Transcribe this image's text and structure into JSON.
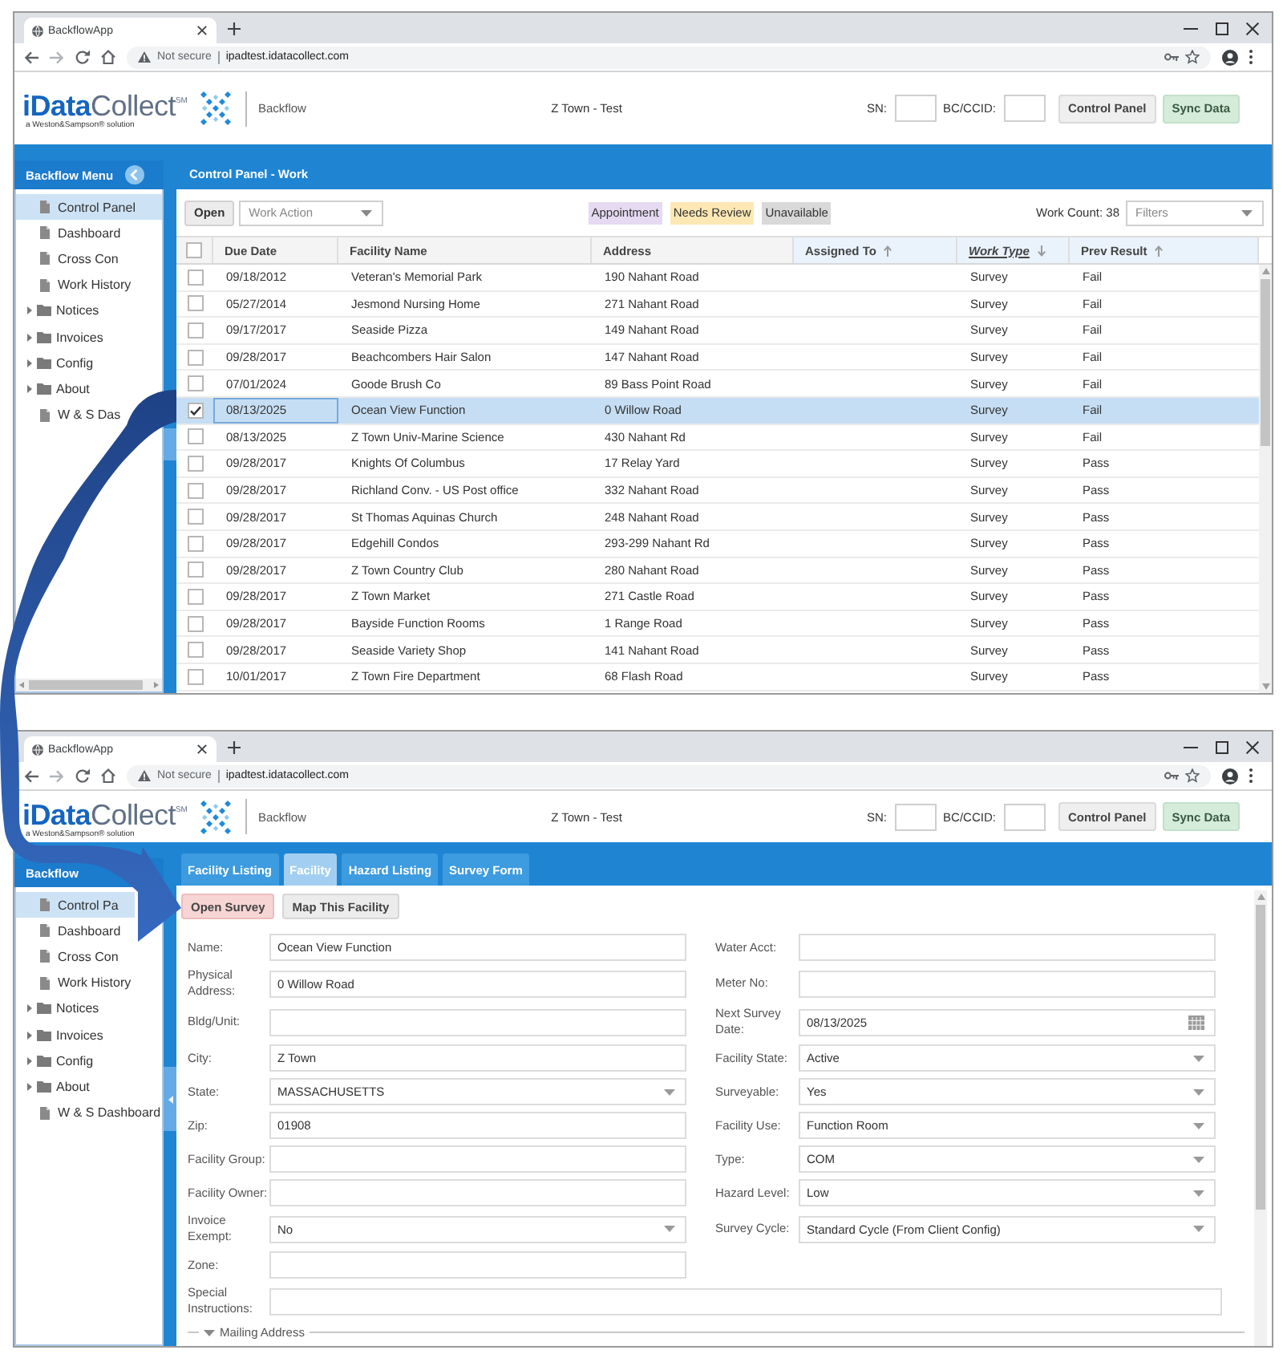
{
  "windows": [
    {
      "kind": "work_list",
      "tab_title": "BackflowApp",
      "security": "Not secure",
      "url": "ipadtest.idatacollect.com",
      "header": {
        "brand": "**iData**Collect$^{SM}$",
        "tagline": "a Weston&Sampson® solution",
        "module": "Backflow",
        "site": "Z Town - Test",
        "sn_label": "SN:",
        "bc_label": "BC/CCID:",
        "buttons": [
          {
            "label": "Control Panel",
            "kind": "default"
          },
          {
            "label": "Sync Data",
            "kind": "sync"
          }
        ]
      },
      "sidebar": {
        "title": "Backflow Menu",
        "items": [
          {
            "label": "Control Panel",
            "kind": "page",
            "selected": true
          },
          {
            "label": "Dashboard",
            "kind": "page",
            "selected": false
          },
          {
            "label": "Cross Con",
            "kind": "page",
            "selected": false
          },
          {
            "label": "Work History",
            "kind": "page",
            "selected": false
          },
          {
            "label": "Notices",
            "kind": "folder",
            "selected": false
          },
          {
            "label": "Invoices",
            "kind": "folder",
            "selected": false
          },
          {
            "label": "Config",
            "kind": "folder",
            "selected": false
          },
          {
            "label": "About",
            "kind": "folder",
            "selected": false
          },
          {
            "label": "W & S Das",
            "kind": "page",
            "selected": false
          }
        ]
      },
      "panel": {
        "title": "Control Panel - Work",
        "open_button": "Open",
        "work_action": {
          "placeholder": "Work Action"
        },
        "legend": [
          {
            "label": "Appointment",
            "color": "#e5daf2"
          },
          {
            "label": "Needs Review",
            "color": "#fde8b4"
          },
          {
            "label": "Unavailable",
            "color": "#d9d9d9"
          }
        ],
        "work_count": "Work Count: 38",
        "filters": {
          "placeholder": "Filters"
        },
        "table": {
          "select_all": false,
          "columns": [
            {
              "label": "Due Date",
              "sortable": false,
              "active": false
            },
            {
              "label": "Facility Name",
              "sortable": false,
              "active": false
            },
            {
              "label": "Address",
              "sortable": false,
              "active": false
            },
            {
              "label": "Assigned To",
              "sortable": true,
              "active": false
            },
            {
              "label": "Work Type",
              "sortable": true,
              "active": true
            },
            {
              "label": "Prev Result",
              "sortable": true,
              "active": false
            }
          ],
          "rows": [
            {
              "due_date": "09/18/2012",
              "facility": "Veteran's Memorial Park",
              "address": "190 Nahant Road",
              "work_type": "Survey",
              "prev_result": "Fail",
              "selected": false
            },
            {
              "due_date": "05/27/2014",
              "facility": "Jesmond Nursing Home",
              "address": "271 Nahant Road",
              "work_type": "Survey",
              "prev_result": "Fail",
              "selected": false
            },
            {
              "due_date": "09/17/2017",
              "facility": "Seaside Pizza",
              "address": "149 Nahant Road",
              "work_type": "Survey",
              "prev_result": "Fail",
              "selected": false
            },
            {
              "due_date": "09/28/2017",
              "facility": "Beachcombers Hair Salon",
              "address": "147 Nahant Road",
              "work_type": "Survey",
              "prev_result": "Fail",
              "selected": false
            },
            {
              "due_date": "07/01/2024",
              "facility": "Goode Brush Co",
              "address": "89 Bass Point Road",
              "work_type": "Survey",
              "prev_result": "Fail",
              "selected": false
            },
            {
              "due_date": "08/13/2025",
              "facility": "Ocean View Function",
              "address": "0 Willow Road",
              "work_type": "Survey",
              "prev_result": "Fail",
              "selected": true
            },
            {
              "due_date": "08/13/2025",
              "facility": "Z Town Univ-Marine Science",
              "address": "430 Nahant Rd",
              "work_type": "Survey",
              "prev_result": "Fail",
              "selected": false
            },
            {
              "due_date": "09/28/2017",
              "facility": "Knights Of Columbus",
              "address": "17 Relay Yard",
              "work_type": "Survey",
              "prev_result": "Pass",
              "selected": false
            },
            {
              "due_date": "09/28/2017",
              "facility": "Richland Conv. - US Post office",
              "address": "332 Nahant Road",
              "work_type": "Survey",
              "prev_result": "Pass",
              "selected": false
            },
            {
              "due_date": "09/28/2017",
              "facility": "St Thomas Aquinas Church",
              "address": "248 Nahant Road",
              "work_type": "Survey",
              "prev_result": "Pass",
              "selected": false
            },
            {
              "due_date": "09/28/2017",
              "facility": "Edgehill Condos",
              "address": "293-299 Nahant Rd",
              "work_type": "Survey",
              "prev_result": "Pass",
              "selected": false
            },
            {
              "due_date": "09/28/2017",
              "facility": "Z Town Country Club",
              "address": "280 Nahant Road",
              "work_type": "Survey",
              "prev_result": "Pass",
              "selected": false
            },
            {
              "due_date": "09/28/2017",
              "facility": "Z Town Market",
              "address": "271 Castle Road",
              "work_type": "Survey",
              "prev_result": "Pass",
              "selected": false
            },
            {
              "due_date": "09/28/2017",
              "facility": "Bayside Function Rooms",
              "address": "1 Range Road",
              "work_type": "Survey",
              "prev_result": "Pass",
              "selected": false
            },
            {
              "due_date": "09/28/2017",
              "facility": "Seaside Variety Shop",
              "address": "141 Nahant Road",
              "work_type": "Survey",
              "prev_result": "Pass",
              "selected": false
            },
            {
              "due_date": "10/01/2017",
              "facility": "Z Town Fire Department",
              "address": "68 Flash Road",
              "work_type": "Survey",
              "prev_result": "Pass",
              "selected": false
            }
          ]
        }
      }
    },
    {
      "kind": "facility_form",
      "tab_title": "BackflowApp",
      "security": "Not secure",
      "url": "ipadtest.idatacollect.com",
      "header": {
        "brand": "**iData**Collect$^{SM}$",
        "tagline": "a Weston&Sampson® solution",
        "module": "Backflow",
        "site": "Z Town - Test",
        "sn_label": "SN:",
        "bc_label": "BC/CCID:",
        "buttons": [
          {
            "label": "Control Panel",
            "kind": "default"
          },
          {
            "label": "Sync Data",
            "kind": "sync"
          }
        ]
      },
      "sidebar": {
        "title": "Backflow",
        "items": [
          {
            "label": "Control Pa",
            "kind": "page",
            "selected": true
          },
          {
            "label": "Dashboard",
            "kind": "page",
            "selected": false
          },
          {
            "label": "Cross Con",
            "kind": "page",
            "selected": false
          },
          {
            "label": "Work History",
            "kind": "page",
            "selected": false
          },
          {
            "label": "Notices",
            "kind": "folder",
            "selected": false
          },
          {
            "label": "Invoices",
            "kind": "folder",
            "selected": false
          },
          {
            "label": "Config",
            "kind": "folder",
            "selected": false
          },
          {
            "label": "About",
            "kind": "folder",
            "selected": false
          },
          {
            "label": "W & S Dashboard",
            "kind": "page",
            "selected": false
          }
        ]
      },
      "panel": {
        "tabs": [
          {
            "label": "Facility Listing",
            "selected": false
          },
          {
            "label": "Facility",
            "selected": true
          },
          {
            "label": "Hazard Listing",
            "selected": false
          },
          {
            "label": "Survey Form",
            "selected": false
          }
        ],
        "actions": [
          {
            "label": "Open Survey",
            "kind": "primary"
          },
          {
            "label": "Map This Facility",
            "kind": "default"
          }
        ],
        "form": {
          "rows": [
            [
              {
                "label": "Name:",
                "kind": "text",
                "value": "Ocean View Function"
              },
              {
                "label": "Water Acct:",
                "kind": "text"
              }
            ],
            [
              {
                "label": "Physical Address:",
                "kind": "text",
                "value": "0 Willow Road"
              },
              {
                "label": "Meter No:",
                "kind": "text"
              }
            ],
            [
              {
                "label": "Bldg/Unit:",
                "kind": "text"
              },
              {
                "label": "Next Survey Date:",
                "kind": "date",
                "value": "08/13/2025"
              }
            ],
            [
              {
                "label": "City:",
                "kind": "text",
                "value": "Z Town"
              },
              {
                "label": "Facility State:",
                "kind": "select",
                "value": "Active"
              }
            ],
            [
              {
                "label": "State:",
                "kind": "select",
                "value": "MASSACHUSETTS"
              },
              {
                "label": "Surveyable:",
                "kind": "select",
                "value": "Yes"
              }
            ],
            [
              {
                "label": "Zip:",
                "kind": "text",
                "value": "01908"
              },
              {
                "label": "Facility Use:",
                "kind": "select",
                "value": "Function Room"
              }
            ],
            [
              {
                "label": "Facility Group:",
                "kind": "text"
              },
              {
                "label": "Type:",
                "kind": "select",
                "value": "COM"
              }
            ],
            [
              {
                "label": "Facility Owner:",
                "kind": "text"
              },
              {
                "label": "Hazard Level:",
                "kind": "select",
                "value": "Low"
              }
            ],
            [
              {
                "label": "Invoice Exempt:",
                "kind": "select",
                "value": "No"
              },
              {
                "label": "Survey Cycle:",
                "kind": "select",
                "value": "Standard Cycle (From Client Config)"
              }
            ],
            [
              {
                "label": "Zone:",
                "kind": "text"
              }
            ],
            [
              {
                "label": "Special Instructions:",
                "kind": "wide_text"
              }
            ]
          ]
        },
        "section": {
          "title": "Mailing Address",
          "expanded": true
        }
      }
    }
  ]
}
